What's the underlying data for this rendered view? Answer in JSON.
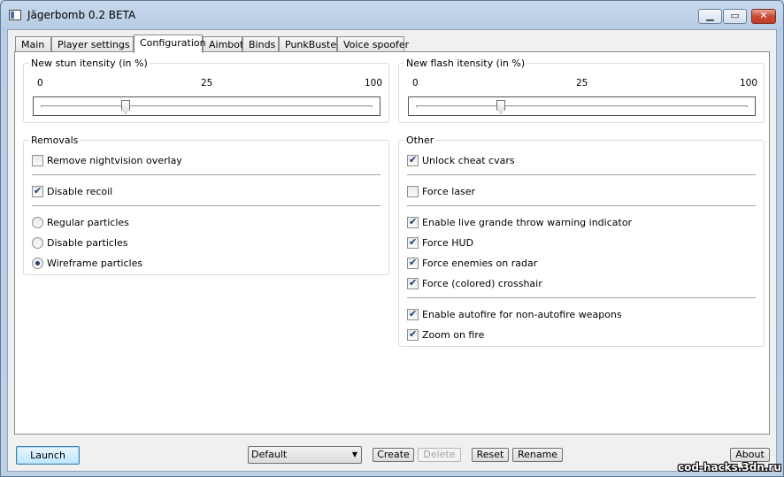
{
  "window": {
    "title": "Jägerbomb 0.2 BETA"
  },
  "tabs": [
    {
      "label": "Main"
    },
    {
      "label": "Player settings"
    },
    {
      "label": "Configuration"
    },
    {
      "label": "Aimbot"
    },
    {
      "label": "Binds"
    },
    {
      "label": "PunkBuster"
    },
    {
      "label": "Voice spoofer"
    }
  ],
  "active_tab": "Configuration",
  "stun": {
    "title": "New stun itensity (in %)",
    "min": "0",
    "mid": "25",
    "max": "100",
    "value": 25
  },
  "flash": {
    "title": "New flash itensity (in %)",
    "min": "0",
    "mid": "25",
    "max": "100",
    "value": 25
  },
  "removals": {
    "title": "Removals",
    "nightvision": {
      "label": "Remove nightvision overlay",
      "checked": false
    },
    "recoil": {
      "label": "Disable recoil",
      "checked": true
    },
    "particles": [
      {
        "label": "Regular particles",
        "selected": false
      },
      {
        "label": "Disable particles",
        "selected": false
      },
      {
        "label": "Wireframe particles",
        "selected": true
      }
    ]
  },
  "other": {
    "title": "Other",
    "items": [
      {
        "label": "Unlock cheat cvars",
        "checked": true
      },
      {
        "label": "Force laser",
        "checked": false
      },
      {
        "label": "Enable live grande throw warning indicator",
        "checked": true
      },
      {
        "label": "Force HUD",
        "checked": true
      },
      {
        "label": "Force enemies on radar",
        "checked": true
      },
      {
        "label": "Force (colored) crosshair",
        "checked": true
      },
      {
        "label": "Enable autofire for non-autofire weapons",
        "checked": true
      },
      {
        "label": "Zoom on fire",
        "checked": true
      }
    ]
  },
  "bottom": {
    "launch": "Launch",
    "profile": "Default",
    "create": "Create",
    "delete": "Delete",
    "reset": "Reset",
    "rename": "Rename",
    "about": "About"
  },
  "watermark": "cod-hacks.3dn.ru"
}
